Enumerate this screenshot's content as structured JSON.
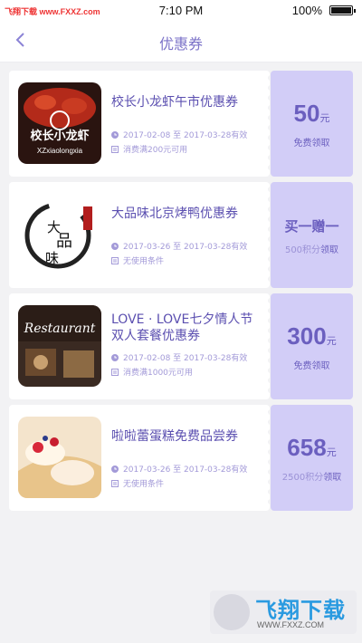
{
  "status_bar": {
    "site_label": "飞翔下载 www.FXXZ.com",
    "time": "7:10 PM",
    "battery": "100%"
  },
  "nav": {
    "back_icon": "chevron-left-icon",
    "title": "优惠券"
  },
  "coupons": [
    {
      "image": "crayfish-photo",
      "title": "校长小龙虾午市优惠券",
      "validity": "2017-02-08 至 2017-03-28有效",
      "condition": "消费满200元可用",
      "amount": "50",
      "unit": "元",
      "action": "免费领取"
    },
    {
      "image": "roast-duck-logo",
      "title": "大品味北京烤鸭优惠券",
      "validity": "2017-03-26 至 2017-03-28有效",
      "condition": "无使用条件",
      "amount_text": "买一赠一",
      "points": "500积分",
      "action": "领取"
    },
    {
      "image": "restaurant-photo",
      "title": "LOVE · LOVE七夕情人节双人套餐优惠券",
      "validity": "2017-02-08 至 2017-03-28有效",
      "condition": "消费满1000元可用",
      "amount": "300",
      "unit": "元",
      "action": "免费领取"
    },
    {
      "image": "cake-photo",
      "title": "啦啦蕾蛋糕免费品尝券",
      "validity": "2017-03-26 至 2017-03-28有效",
      "condition": "无使用条件",
      "amount": "658",
      "unit": "元",
      "points": "2500积分",
      "action": "领取"
    }
  ],
  "watermark": {
    "brand": "飞翔下载",
    "url": "WWW.FXXZ.COM"
  },
  "colors": {
    "accent": "#7b72c8",
    "coupon_right_bg": "#d2cdf7",
    "page_bg": "#f2f2f4"
  }
}
